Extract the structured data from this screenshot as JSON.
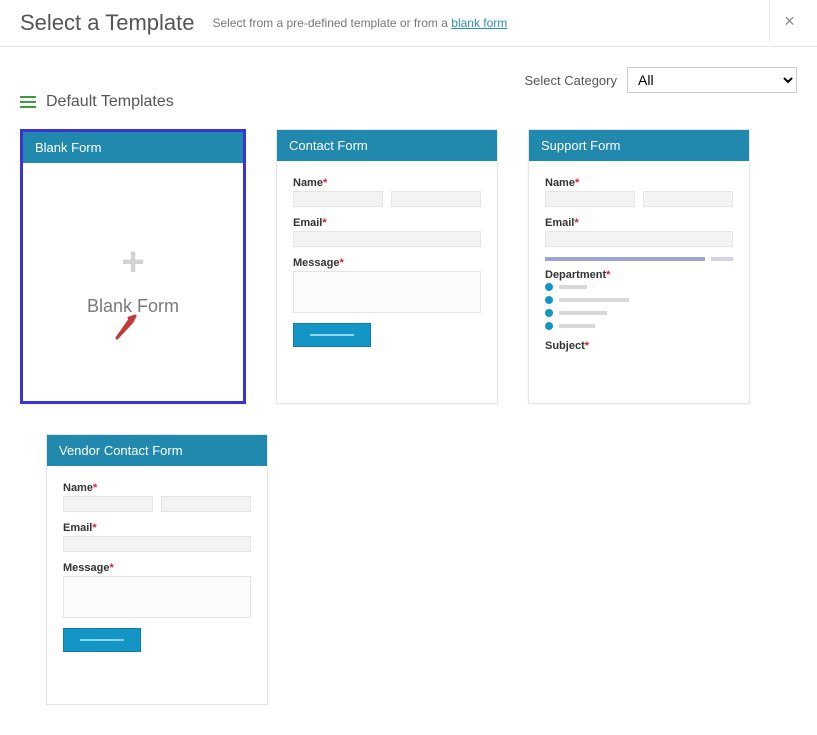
{
  "header": {
    "title": "Select a Template",
    "subtitle_pre": "Select from a pre-defined template or from a ",
    "subtitle_link": "blank form"
  },
  "category": {
    "label": "Select Category",
    "selected": "All"
  },
  "section": {
    "title": "Default Templates"
  },
  "cards": {
    "blank": {
      "header": "Blank Form",
      "center_label": "Blank Form"
    },
    "contact": {
      "header": "Contact Form",
      "fields": {
        "name": "Name",
        "email": "Email",
        "message": "Message"
      }
    },
    "support": {
      "header": "Support Form",
      "fields": {
        "name": "Name",
        "email": "Email",
        "department": "Department",
        "subject": "Subject"
      }
    },
    "vendor": {
      "header": "Vendor Contact Form",
      "fields": {
        "name": "Name",
        "email": "Email",
        "message": "Message"
      }
    }
  }
}
